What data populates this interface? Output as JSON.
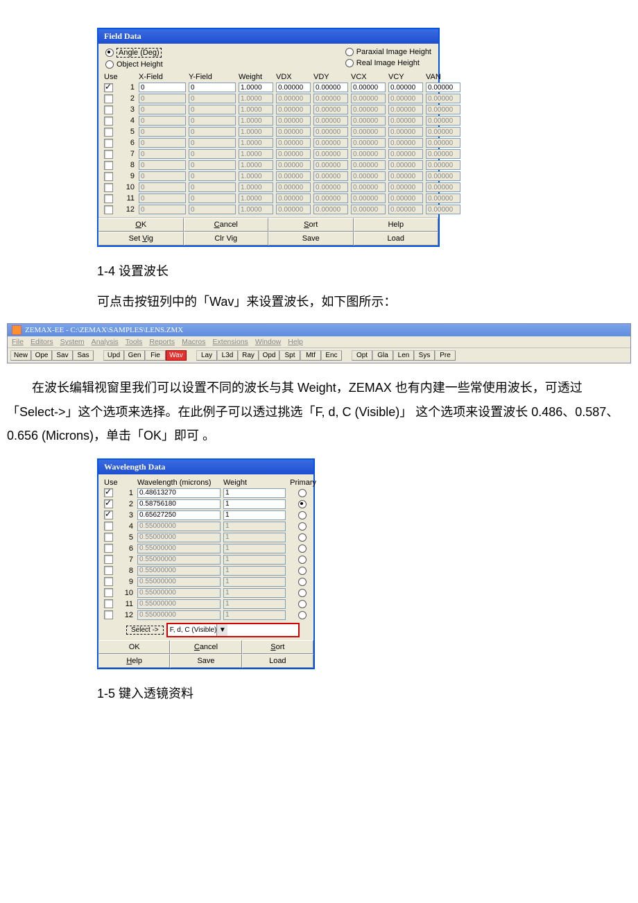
{
  "field_data": {
    "title": "Field Data",
    "radios_left": [
      "Angle (Deg)",
      "Object Height"
    ],
    "radios_right": [
      "Paraxial Image Height",
      "Real Image Height"
    ],
    "headers": [
      "Use",
      "",
      "X-Field",
      "Y-Field",
      "Weight",
      "VDX",
      "VDY",
      "VCX",
      "VCY",
      "VAN"
    ],
    "rows": [
      {
        "n": "1",
        "use": true,
        "x": "0",
        "y": "0",
        "w": "1.0000",
        "vdx": "0.00000",
        "vdy": "0.00000",
        "vcx": "0.00000",
        "vcy": "0.00000",
        "van": "0.00000"
      },
      {
        "n": "2",
        "use": false,
        "x": "0",
        "y": "0",
        "w": "1.0000",
        "vdx": "0.00000",
        "vdy": "0.00000",
        "vcx": "0.00000",
        "vcy": "0.00000",
        "van": "0.00000"
      },
      {
        "n": "3",
        "use": false,
        "x": "0",
        "y": "0",
        "w": "1.0000",
        "vdx": "0.00000",
        "vdy": "0.00000",
        "vcx": "0.00000",
        "vcy": "0.00000",
        "van": "0.00000"
      },
      {
        "n": "4",
        "use": false,
        "x": "0",
        "y": "0",
        "w": "1.0000",
        "vdx": "0.00000",
        "vdy": "0.00000",
        "vcx": "0.00000",
        "vcy": "0.00000",
        "van": "0.00000"
      },
      {
        "n": "5",
        "use": false,
        "x": "0",
        "y": "0",
        "w": "1.0000",
        "vdx": "0.00000",
        "vdy": "0.00000",
        "vcx": "0.00000",
        "vcy": "0.00000",
        "van": "0.00000"
      },
      {
        "n": "6",
        "use": false,
        "x": "0",
        "y": "0",
        "w": "1.0000",
        "vdx": "0.00000",
        "vdy": "0.00000",
        "vcx": "0.00000",
        "vcy": "0.00000",
        "van": "0.00000"
      },
      {
        "n": "7",
        "use": false,
        "x": "0",
        "y": "0",
        "w": "1.0000",
        "vdx": "0.00000",
        "vdy": "0.00000",
        "vcx": "0.00000",
        "vcy": "0.00000",
        "van": "0.00000"
      },
      {
        "n": "8",
        "use": false,
        "x": "0",
        "y": "0",
        "w": "1.0000",
        "vdx": "0.00000",
        "vdy": "0.00000",
        "vcx": "0.00000",
        "vcy": "0.00000",
        "van": "0.00000"
      },
      {
        "n": "9",
        "use": false,
        "x": "0",
        "y": "0",
        "w": "1.0000",
        "vdx": "0.00000",
        "vdy": "0.00000",
        "vcx": "0.00000",
        "vcy": "0.00000",
        "van": "0.00000"
      },
      {
        "n": "10",
        "use": false,
        "x": "0",
        "y": "0",
        "w": "1.0000",
        "vdx": "0.00000",
        "vdy": "0.00000",
        "vcx": "0.00000",
        "vcy": "0.00000",
        "van": "0.00000"
      },
      {
        "n": "11",
        "use": false,
        "x": "0",
        "y": "0",
        "w": "1.0000",
        "vdx": "0.00000",
        "vdy": "0.00000",
        "vcx": "0.00000",
        "vcy": "0.00000",
        "van": "0.00000"
      },
      {
        "n": "12",
        "use": false,
        "x": "0",
        "y": "0",
        "w": "1.0000",
        "vdx": "0.00000",
        "vdy": "0.00000",
        "vcx": "0.00000",
        "vcy": "0.00000",
        "van": "0.00000"
      }
    ],
    "buttons_row1": [
      "OK",
      "Cancel",
      "Sort",
      "Help"
    ],
    "buttons_row2": [
      "Set Vig",
      "Clr Vig",
      "Save",
      "Load"
    ]
  },
  "text1_heading": "1-4 设置波长",
  "text1_body": "可点击按钮列中的「Wav」来设置波长，如下图所示：",
  "zemax": {
    "title": "ZEMAX-EE - C:\\ZEMAX\\SAMPLES\\LENS.ZMX",
    "menus": [
      "File",
      "Editors",
      "System",
      "Analysis",
      "Tools",
      "Reports",
      "Macros",
      "Extensions",
      "Window",
      "Help"
    ],
    "tb_g1": [
      "New",
      "Ope",
      "Sav",
      "Sas"
    ],
    "tb_g2": [
      "Upd",
      "Gen",
      "Fie",
      "Wav"
    ],
    "tb_g3": [
      "Lay",
      "L3d",
      "Ray",
      "Opd",
      "Spt",
      "Mtf",
      "Enc"
    ],
    "tb_g4": [
      "Opt",
      "Gla",
      "Len",
      "Sys",
      "Pre"
    ]
  },
  "text2_body": "　　在波长编辑视窗里我们可以设置不同的波长与其 Weight，ZEMAX 也有内建一些常使用波长，可透过「Select->」这个选项来选择。在此例子可以透过挑选「F, d, C (Visible)」 这个选项来设置波长 0.486、0.587、0.656  (Microns)，单击「OK」即可 。",
  "wavelength": {
    "title": "Wavelength Data",
    "headers": [
      "Use",
      "",
      "Wavelength (microns)",
      "Weight",
      "Primary"
    ],
    "rows": [
      {
        "n": "1",
        "use": true,
        "wl": "0.48613270",
        "w": "1",
        "primary": false
      },
      {
        "n": "2",
        "use": true,
        "wl": "0.58756180",
        "w": "1",
        "primary": true
      },
      {
        "n": "3",
        "use": true,
        "wl": "0.65627250",
        "w": "1",
        "primary": false
      },
      {
        "n": "4",
        "use": false,
        "wl": "0.55000000",
        "w": "1",
        "primary": false
      },
      {
        "n": "5",
        "use": false,
        "wl": "0.55000000",
        "w": "1",
        "primary": false
      },
      {
        "n": "6",
        "use": false,
        "wl": "0.55000000",
        "w": "1",
        "primary": false
      },
      {
        "n": "7",
        "use": false,
        "wl": "0.55000000",
        "w": "1",
        "primary": false
      },
      {
        "n": "8",
        "use": false,
        "wl": "0.55000000",
        "w": "1",
        "primary": false
      },
      {
        "n": "9",
        "use": false,
        "wl": "0.55000000",
        "w": "1",
        "primary": false
      },
      {
        "n": "10",
        "use": false,
        "wl": "0.55000000",
        "w": "1",
        "primary": false
      },
      {
        "n": "11",
        "use": false,
        "wl": "0.55000000",
        "w": "1",
        "primary": false
      },
      {
        "n": "12",
        "use": false,
        "wl": "0.55000000",
        "w": "1",
        "primary": false
      }
    ],
    "select_label": "Select ->",
    "select_value": "F, d, C (Visible)",
    "buttons_row1": [
      "OK",
      "Cancel",
      "Sort"
    ],
    "buttons_row2": [
      "Help",
      "Save",
      "Load"
    ]
  },
  "text3_heading": "1-5 键入透镜资料"
}
